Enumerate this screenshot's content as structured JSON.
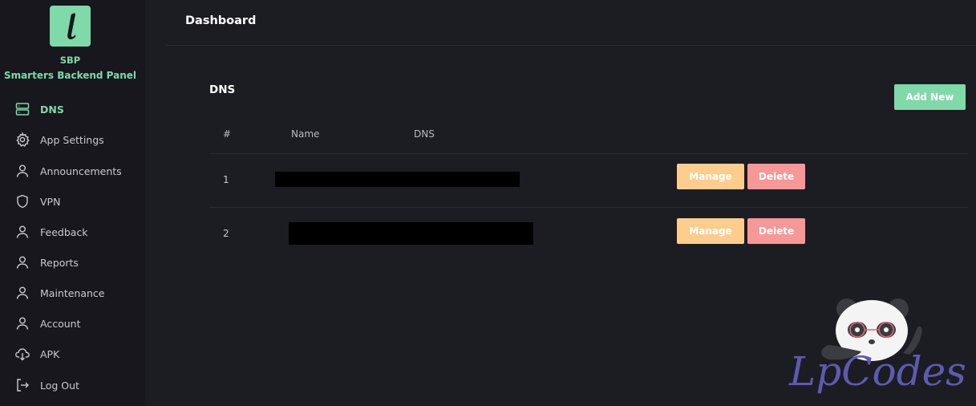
{
  "brand": {
    "short_name": "SBP",
    "full_name": "Smarters Backend Panel",
    "logo_letter": "l"
  },
  "sidebar": {
    "items": [
      {
        "label": "DNS",
        "icon": "server-icon",
        "active": true
      },
      {
        "label": "App Settings",
        "icon": "gear-icon",
        "active": false
      },
      {
        "label": "Announcements",
        "icon": "user-icon",
        "active": false
      },
      {
        "label": "VPN",
        "icon": "shield-icon",
        "active": false
      },
      {
        "label": "Feedback",
        "icon": "user-icon",
        "active": false
      },
      {
        "label": "Reports",
        "icon": "user-icon",
        "active": false
      },
      {
        "label": "Maintenance",
        "icon": "user-icon",
        "active": false
      },
      {
        "label": "Account",
        "icon": "user-icon",
        "active": false
      },
      {
        "label": "APK",
        "icon": "cloud-download-icon",
        "active": false
      },
      {
        "label": "Log Out",
        "icon": "logout-icon",
        "active": false
      }
    ]
  },
  "header": {
    "title": "Dashboard"
  },
  "main": {
    "section_title": "DNS",
    "add_button": "Add New",
    "table": {
      "columns": [
        "#",
        "Name",
        "DNS"
      ],
      "rows": [
        {
          "num": "1",
          "manage": "Manage",
          "delete": "Delete"
        },
        {
          "num": "2",
          "manage": "Manage",
          "delete": "Delete"
        }
      ]
    }
  },
  "watermark": {
    "text": "LpCodes"
  },
  "colors": {
    "accent": "#7fd9a8",
    "manage": "#fdcd8d",
    "delete": "#f79797",
    "background": "#1c1c23",
    "sidebar": "#17171d"
  }
}
